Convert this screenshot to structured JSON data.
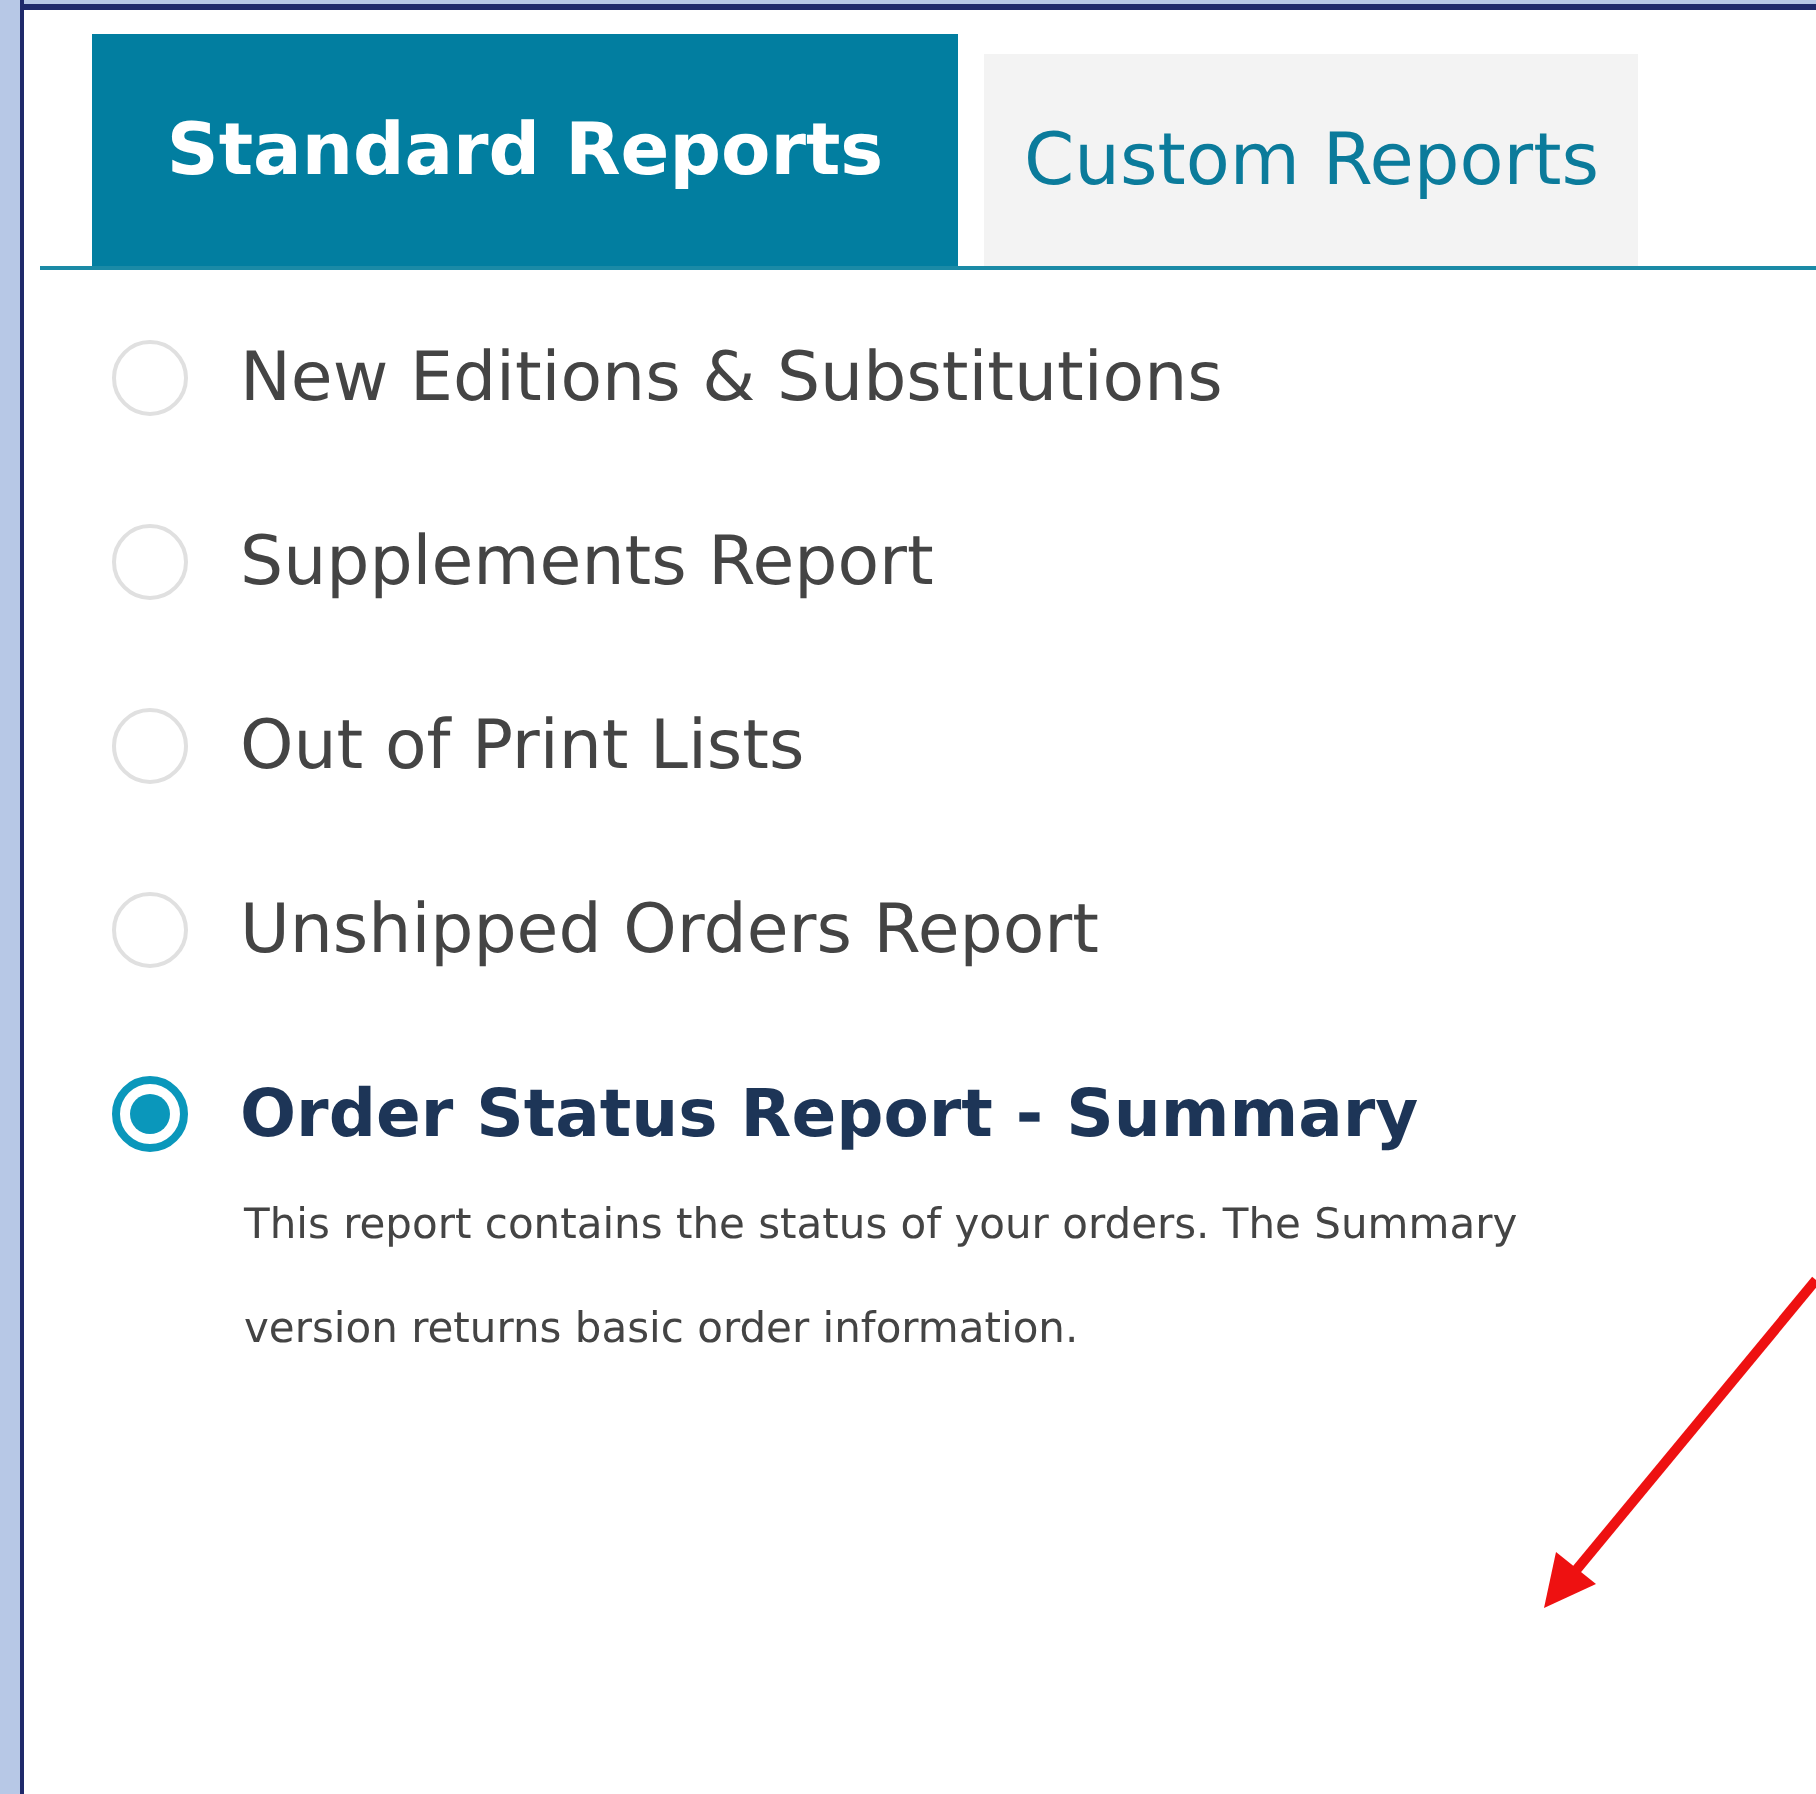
{
  "tabs": [
    {
      "label": "Standard Reports",
      "selected": true
    },
    {
      "label": "Custom Reports",
      "selected": false
    }
  ],
  "reports": [
    {
      "label": "New Editions & Substitutions",
      "selected": false
    },
    {
      "label": "Supplements Report",
      "selected": false
    },
    {
      "label": "Out of Print Lists",
      "selected": false
    },
    {
      "label": "Unshipped Orders Report",
      "selected": false
    },
    {
      "label": "Order Status Report - Summary",
      "selected": true,
      "description": "This report contains the status of your orders. The Summary version returns basic order information."
    }
  ]
}
